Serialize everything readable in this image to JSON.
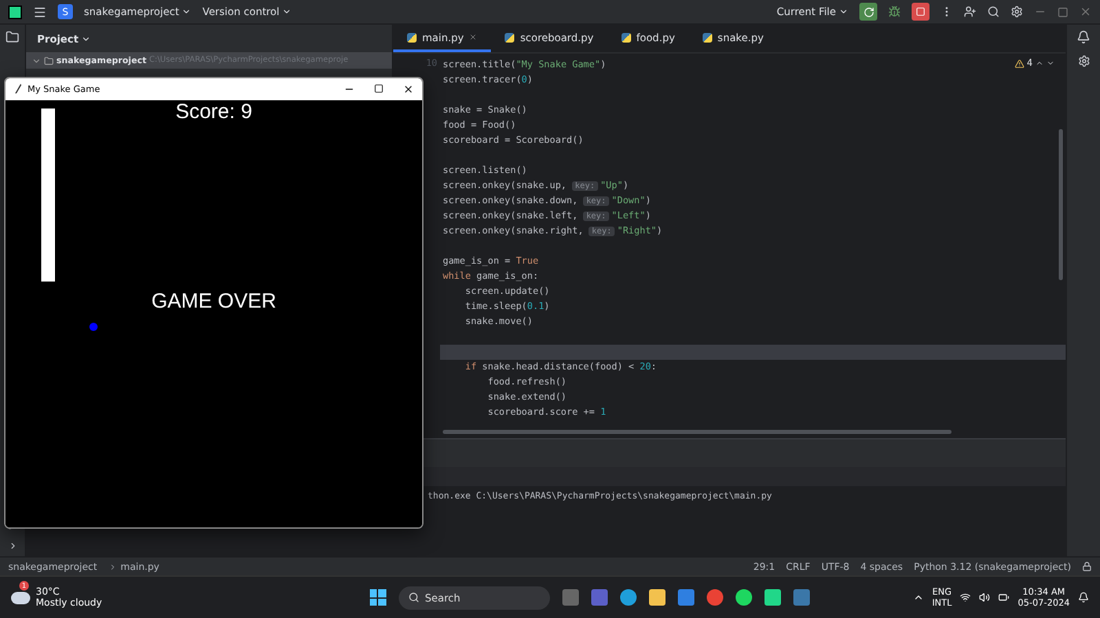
{
  "topbar": {
    "project_badge": "S",
    "project": "snakegameproject",
    "vcs": "Version control",
    "run_config": "Current File"
  },
  "project_panel": {
    "title": "Project",
    "root": {
      "name": "snakegameproject",
      "path": "C:\\Users\\PARAS\\PycharmProjects\\snakegameproje",
      "expanded": true,
      "selected": true
    }
  },
  "tabs": [
    {
      "label": "main.py",
      "selected": true
    },
    {
      "label": "scoreboard.py",
      "selected": false
    },
    {
      "label": "food.py",
      "selected": false
    },
    {
      "label": "snake.py",
      "selected": false
    }
  ],
  "editor": {
    "first_line_number": "10",
    "warnings": "4",
    "lines": [
      {
        "kind": "code",
        "current": false,
        "segments": [
          {
            "kind": "plain",
            "t": "screen.title("
          },
          {
            "kind": "string",
            "t": "\"My Snake Game\""
          },
          {
            "kind": "plain",
            "t": ")"
          }
        ]
      },
      {
        "kind": "code",
        "current": false,
        "segments": [
          {
            "kind": "plain",
            "t": "screen.tracer("
          },
          {
            "kind": "number",
            "t": "0"
          },
          {
            "kind": "plain",
            "t": ")"
          }
        ]
      },
      {
        "kind": "blank",
        "current": false
      },
      {
        "kind": "code",
        "current": false,
        "segments": [
          {
            "kind": "plain",
            "t": "snake = Snake()"
          }
        ]
      },
      {
        "kind": "code",
        "current": false,
        "segments": [
          {
            "kind": "plain",
            "t": "food = Food()"
          }
        ]
      },
      {
        "kind": "code",
        "current": false,
        "segments": [
          {
            "kind": "plain",
            "t": "scoreboard = Scoreboard()"
          }
        ]
      },
      {
        "kind": "blank",
        "current": false
      },
      {
        "kind": "code",
        "current": false,
        "segments": [
          {
            "kind": "plain",
            "t": "screen.listen()"
          }
        ]
      },
      {
        "kind": "code",
        "current": false,
        "segments": [
          {
            "kind": "plain",
            "t": "screen.onkey(snake.up, "
          },
          {
            "kind": "hint",
            "t": "key:"
          },
          {
            "kind": "string",
            "t": "\"Up\""
          },
          {
            "kind": "plain",
            "t": ")"
          }
        ]
      },
      {
        "kind": "code",
        "current": false,
        "segments": [
          {
            "kind": "plain",
            "t": "screen.onkey(snake.down, "
          },
          {
            "kind": "hint",
            "t": "key:"
          },
          {
            "kind": "string",
            "t": "\"Down\""
          },
          {
            "kind": "plain",
            "t": ")"
          }
        ]
      },
      {
        "kind": "code",
        "current": false,
        "segments": [
          {
            "kind": "plain",
            "t": "screen.onkey(snake.left, "
          },
          {
            "kind": "hint",
            "t": "key:"
          },
          {
            "kind": "string",
            "t": "\"Left\""
          },
          {
            "kind": "plain",
            "t": ")"
          }
        ]
      },
      {
        "kind": "code",
        "current": false,
        "segments": [
          {
            "kind": "plain",
            "t": "screen.onkey(snake.right, "
          },
          {
            "kind": "hint",
            "t": "key:"
          },
          {
            "kind": "string",
            "t": "\"Right\""
          },
          {
            "kind": "plain",
            "t": ")"
          }
        ]
      },
      {
        "kind": "blank",
        "current": false
      },
      {
        "kind": "code",
        "current": false,
        "segments": [
          {
            "kind": "plain",
            "t": "game_is_on = "
          },
          {
            "kind": "keyword",
            "t": "True"
          }
        ]
      },
      {
        "kind": "code",
        "current": false,
        "segments": [
          {
            "kind": "keyword",
            "t": "while"
          },
          {
            "kind": "plain",
            "t": " game_is_on:"
          }
        ]
      },
      {
        "kind": "code",
        "current": false,
        "segments": [
          {
            "kind": "plain",
            "t": "    screen.update()"
          }
        ]
      },
      {
        "kind": "code",
        "current": false,
        "segments": [
          {
            "kind": "plain",
            "t": "    time.sleep("
          },
          {
            "kind": "number",
            "t": "0.1"
          },
          {
            "kind": "plain",
            "t": ")"
          }
        ]
      },
      {
        "kind": "code",
        "current": false,
        "segments": [
          {
            "kind": "plain",
            "t": "    snake.move()"
          }
        ]
      },
      {
        "kind": "blank",
        "current": false
      },
      {
        "kind": "blank",
        "current": true
      },
      {
        "kind": "code",
        "current": false,
        "segments": [
          {
            "kind": "keyword",
            "t": "    if"
          },
          {
            "kind": "plain",
            "t": " snake.head.distance(food) < "
          },
          {
            "kind": "number",
            "t": "20"
          },
          {
            "kind": "plain",
            "t": ":"
          }
        ]
      },
      {
        "kind": "code",
        "current": false,
        "segments": [
          {
            "kind": "plain",
            "t": "        food.refresh()"
          }
        ]
      },
      {
        "kind": "code",
        "current": false,
        "segments": [
          {
            "kind": "plain",
            "t": "        snake.extend()"
          }
        ]
      },
      {
        "kind": "code",
        "current": false,
        "segments": [
          {
            "kind": "plain",
            "t": "        scoreboard.score += "
          },
          {
            "kind": "number",
            "t": "1"
          }
        ]
      }
    ]
  },
  "terminal": {
    "output": "thon.exe C:\\Users\\PARAS\\PycharmProjects\\snakegameproject\\main.py"
  },
  "game_window": {
    "title": "My Snake Game",
    "score": "Score: 9",
    "message": "GAME OVER"
  },
  "status_bar": {
    "breadcrumbs": [
      "snakegameproject",
      "main.py"
    ],
    "items": [
      "29:1",
      "CRLF",
      "UTF-8",
      "4 spaces",
      "Python 3.12 (snakegameproject)"
    ]
  },
  "taskbar": {
    "weather": {
      "temp": "30°C",
      "condition": "Mostly cloudy",
      "badge": "1"
    },
    "search": "Search",
    "language": [
      "ENG",
      "INTL"
    ],
    "time": "10:34 AM",
    "date": "05-07-2024"
  }
}
